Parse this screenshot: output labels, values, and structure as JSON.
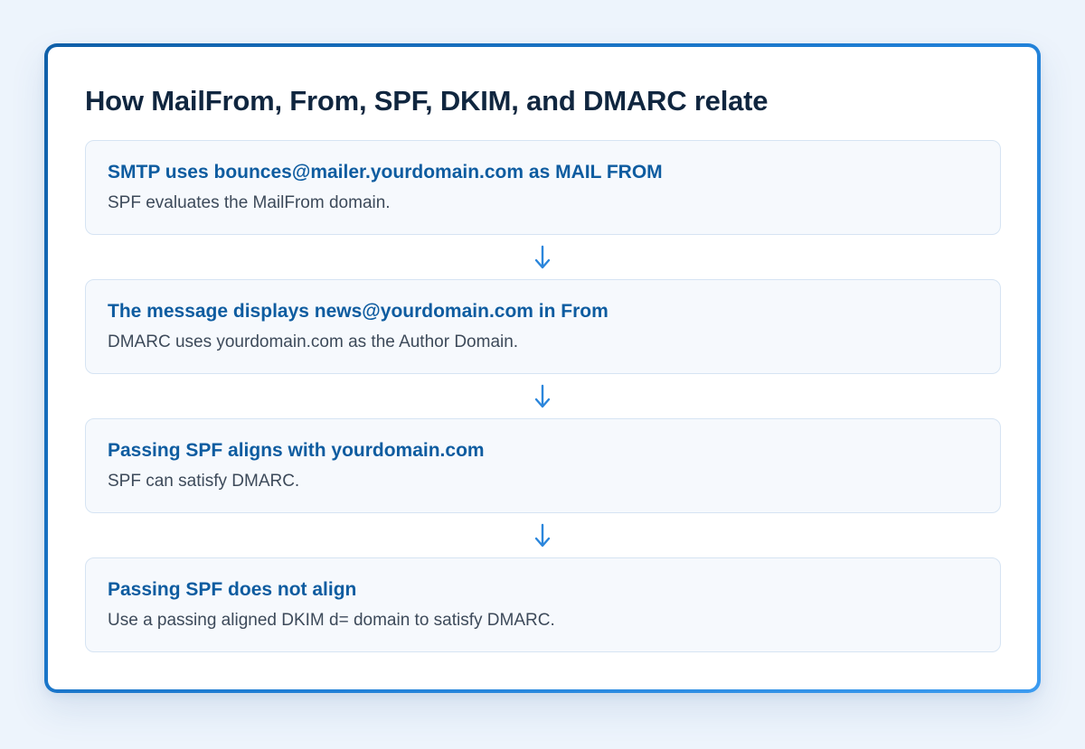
{
  "title": "How MailFrom, From, SPF, DKIM, and DMARC relate",
  "steps": [
    {
      "heading": "SMTP uses bounces@mailer.yourdomain.com as MAIL FROM",
      "description": "SPF evaluates the MailFrom domain."
    },
    {
      "heading": "The message displays news@yourdomain.com in From",
      "description": "DMARC uses yourdomain.com as the Author Domain."
    },
    {
      "heading": "Passing SPF aligns with yourdomain.com",
      "description": "SPF can satisfy DMARC."
    },
    {
      "heading": "Passing SPF does not align",
      "description": "Use a passing aligned DKIM d= domain to satisfy DMARC."
    }
  ],
  "connector_icon": "arrow-down-icon",
  "colors": {
    "accent": "#1f7fd6",
    "heading": "#0e5ca0",
    "title": "#10263f",
    "step_background": "#f6f9fd",
    "step_border": "#d6e4f3"
  }
}
